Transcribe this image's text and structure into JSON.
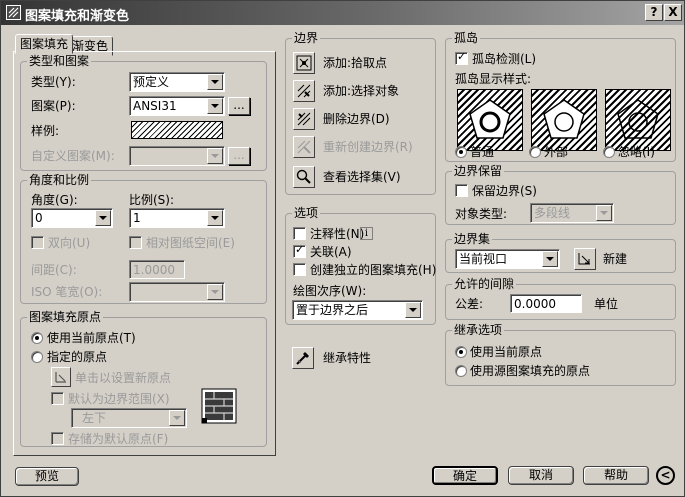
{
  "window": {
    "title": "图案填充和渐变色",
    "help_btn": "?",
    "close_btn": "X"
  },
  "tabs": [
    "图案填充",
    "渐变色"
  ],
  "type_pattern": {
    "title": "类型和图案",
    "type_label": "类型(Y):",
    "type_value": "预定义",
    "pattern_label": "图案(P):",
    "pattern_value": "ANSI31",
    "browse": "...",
    "swatch_label": "样例:",
    "custom_label": "自定义图案(M):",
    "custom_browse": "..."
  },
  "angle_scale": {
    "title": "角度和比例",
    "angle_label": "角度(G):",
    "angle_value": "0",
    "scale_label": "比例(S):",
    "scale_value": "1",
    "double_label": "双向(U)",
    "relative_label": "相对图纸空间(E)",
    "spacing_label": "间距(C):",
    "spacing_value": "1.0000",
    "iso_label": "ISO 笔宽(O):"
  },
  "origin": {
    "title": "图案填充原点",
    "current_label": "使用当前原点(T)",
    "specified_label": "指定的原点",
    "click_label": "单击以设置新原点",
    "default_extents_label": "默认为边界范围(X)",
    "extents_value": "左下",
    "store_label": "存储为默认原点(F)"
  },
  "boundaries": {
    "title": "边界",
    "add_pick": "添加:拾取点",
    "add_select": "添加:选择对象",
    "remove": "删除边界(D)",
    "recreate": "重新创建边界(R)",
    "view": "查看选择集(V)"
  },
  "options": {
    "title": "选项",
    "annotative": "注释性(N)",
    "info": "i",
    "associative": "关联(A)",
    "separate": "创建独立的图案填充(H)",
    "draw_order_label": "绘图次序(W):",
    "draw_order_value": "置于边界之后"
  },
  "inherit_label": "继承特性",
  "islands": {
    "title": "孤岛",
    "detect_label": "孤岛检测(L)",
    "style_label": "孤岛显示样式:",
    "normal": "普通",
    "outer": "外部",
    "ignore": "忽略(I)"
  },
  "boundary_retention": {
    "title": "边界保留",
    "retain_label": "保留边界(S)",
    "object_type_label": "对象类型:",
    "object_type_value": "多段线"
  },
  "boundary_set": {
    "title": "边界集",
    "value": "当前视口",
    "new_label": "新建"
  },
  "gap": {
    "title": "允许的间隙",
    "tolerance_label": "公差:",
    "tolerance_value": "0.0000",
    "unit": "单位"
  },
  "inherit_options": {
    "title": "继承选项",
    "current": "使用当前原点",
    "source": "使用源图案填充的原点"
  },
  "footer": {
    "preview": "预览",
    "ok": "确定",
    "cancel": "取消",
    "help": "帮助",
    "more": "<"
  }
}
